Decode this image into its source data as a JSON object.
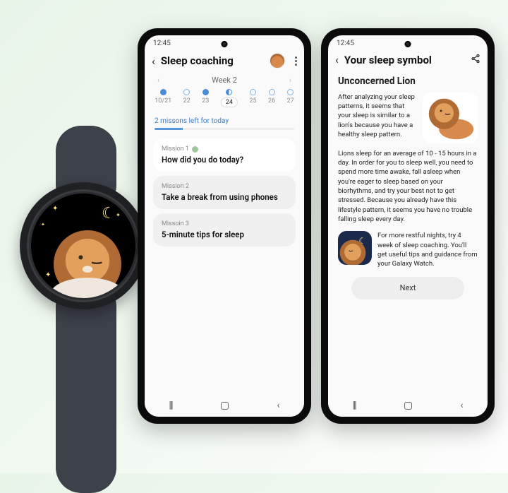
{
  "status_time": "12:45",
  "phone_left": {
    "title": "Sleep coaching",
    "week_label": "Week 2",
    "days": [
      {
        "d": "10/21",
        "state": "full"
      },
      {
        "d": "22",
        "state": "empty"
      },
      {
        "d": "23",
        "state": "full"
      },
      {
        "d": "24",
        "state": "half",
        "selected": true
      },
      {
        "d": "25",
        "state": "empty"
      },
      {
        "d": "26",
        "state": "empty"
      },
      {
        "d": "27",
        "state": "empty"
      }
    ],
    "summary": "2 missons left for today",
    "missions": [
      {
        "tag": "Mission 1",
        "done": true,
        "title": "How did you do today?"
      },
      {
        "tag": "Mission 2",
        "done": false,
        "title": "Take a break from using phones"
      },
      {
        "tag": "Missoin 3",
        "done": false,
        "title": "5-minute tips for sleep"
      }
    ]
  },
  "phone_right": {
    "title": "Your sleep symbol",
    "heading": "Unconcerned Lion",
    "p1": "After analyzing your sleep patterns, it seems that your sleep is similar to a lion's because you have a healthy sleep pattern.",
    "p2": "Lions sleep for an average of 10 - 15 hours in a day. In order for you to sleep well, you need to spend more time awake, fall asleep when you're eager to sleep based on your biorhythms, and try your best not to get stressed. Because you already have this lifestyle pattern, it seems you have no trouble falling sleep every day.",
    "tip": "For more restful nights, try 4 week of sleep coaching. You'll get useful tips and guidance from your Galaxy Watch.",
    "next": "Next"
  }
}
